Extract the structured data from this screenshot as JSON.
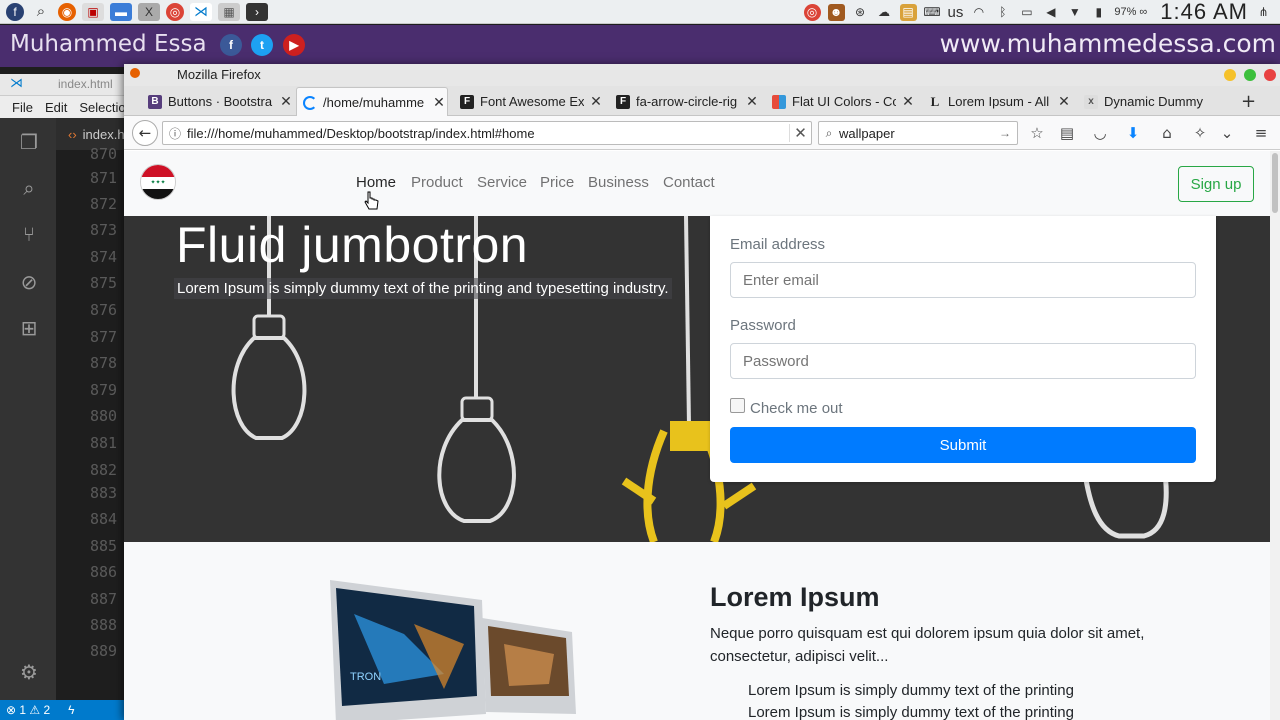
{
  "system": {
    "lang": "us",
    "battery": "97% ∞",
    "clock": "1:46 AM"
  },
  "banner": {
    "name": "Muhammed Essa",
    "url": "www.muhammedessa.com"
  },
  "vscode": {
    "window_title": "index.html",
    "menu": [
      "File",
      "Edit",
      "Selectio"
    ],
    "tab": "index.h",
    "line_numbers": [
      "870",
      "871",
      "872",
      "873",
      "874",
      "875",
      "876",
      "877",
      "878",
      "879",
      "880",
      "881",
      "882",
      "883",
      "884",
      "885",
      "886",
      "887",
      "888",
      "889"
    ],
    "status": "⊗ 1 ⚠ 2"
  },
  "firefox": {
    "title": "Mozilla Firefox",
    "tabs": [
      {
        "label": "Buttons · Bootstra",
        "fav": "B"
      },
      {
        "label": "/home/muhamme",
        "fav": ""
      },
      {
        "label": "Font Awesome Ex",
        "fav": "F"
      },
      {
        "label": "fa-arrow-circle-rig",
        "fav": "F"
      },
      {
        "label": "Flat UI Colors - Col",
        "fav": ""
      },
      {
        "label": "Lorem Ipsum - All",
        "fav": "L"
      },
      {
        "label": "Dynamic Dummy",
        "fav": "x"
      }
    ],
    "url": "file:///home/muhammed/Desktop/bootstrap/index.html#home",
    "search": "wallpaper"
  },
  "page": {
    "nav": [
      "Home",
      "Product",
      "Service",
      "Price",
      "Business",
      "Contact"
    ],
    "signup": "Sign up",
    "jumbotron": {
      "title": "Fluid jumbotron",
      "lead": "Lorem Ipsum is simply dummy text of the printing and typesetting industry."
    },
    "form": {
      "email_label": "Email address",
      "email_placeholder": "Enter email",
      "password_label": "Password",
      "password_placeholder": "Password",
      "check_label": "Check me out",
      "submit": "Submit"
    },
    "section2": {
      "title": "Lorem Ipsum",
      "text": "Neque porro quisquam est qui dolorem ipsum quia dolor sit amet, consectetur, adipisci velit...",
      "list": [
        "Lorem Ipsum is simply dummy text of the printing",
        "Lorem Ipsum is simply dummy text of the printing"
      ]
    }
  },
  "colors": {
    "primary": "#007bff",
    "success": "#28a745",
    "banner": "#4a2d6e"
  }
}
